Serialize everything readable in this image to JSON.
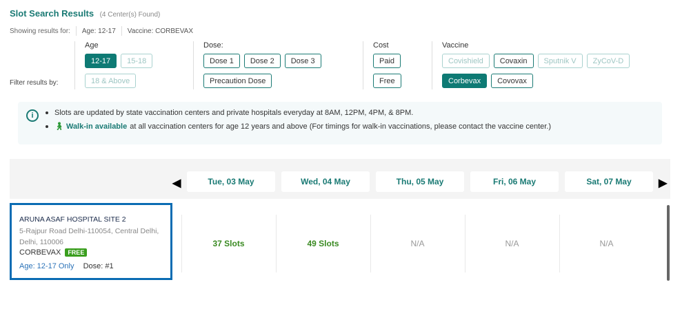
{
  "header": {
    "title": "Slot Search Results",
    "count": "(4 Center(s) Found)"
  },
  "showing": {
    "label": "Showing results for:",
    "age": "Age: 12-17",
    "vaccine": "Vaccine: CORBEVAX"
  },
  "filter_label": "Filter results by:",
  "filters": {
    "age": {
      "title": "Age",
      "options": [
        "12-17",
        "15-18",
        "18 & Above"
      ],
      "selected": "12-17"
    },
    "dose": {
      "title": "Dose:",
      "options": [
        "Dose 1",
        "Dose 2",
        "Dose 3",
        "Precaution Dose"
      ]
    },
    "cost": {
      "title": "Cost",
      "options": [
        "Paid",
        "Free"
      ]
    },
    "vaccine": {
      "title": "Vaccine",
      "options": [
        "Covishield",
        "Covaxin",
        "Sputnik V",
        "ZyCoV-D",
        "Corbevax",
        "Covovax"
      ],
      "selected": "Corbevax"
    }
  },
  "info": {
    "line1": "Slots are updated by state vaccination centers and private hospitals everyday at 8AM, 12PM, 4PM, & 8PM.",
    "walkin_label": "Walk-in available",
    "line2": "at all vaccination centers for age 12 years and above (For timings for walk-in vaccinations, please contact the vaccine center.)"
  },
  "dates": [
    "Tue, 03 May",
    "Wed, 04 May",
    "Thu, 05 May",
    "Fri, 06 May",
    "Sat, 07 May"
  ],
  "center": {
    "name": "ARUNA ASAF HOSPITAL SITE 2",
    "address": "5-Rajpur Road Delhi-110054, Central Delhi, Delhi, 110006",
    "vaccine": "CORBEVAX",
    "badge": "FREE",
    "age": "Age: 12-17 Only",
    "dose": "Dose: #1"
  },
  "slots": [
    "37 Slots",
    "49 Slots",
    "N/A",
    "N/A",
    "N/A"
  ],
  "colors": {
    "accent": "#1a7a74",
    "selected": "#0e7a74",
    "free_badge": "#3a9e1e",
    "card_border": "#0a6cb3"
  }
}
